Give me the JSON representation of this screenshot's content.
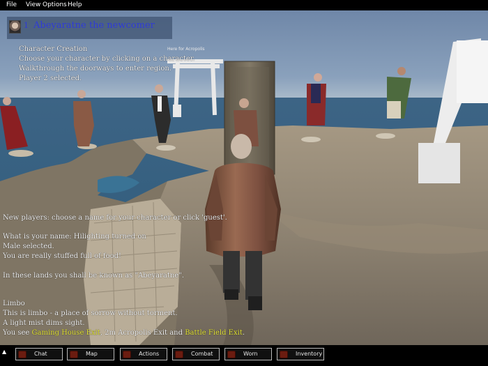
{
  "menu": [
    "File",
    "View",
    "Options",
    "Help"
  ],
  "player": {
    "number": "1",
    "name": "Abeyaratne the newcomer"
  },
  "sign_label": "Here for Acropolis",
  "intro_lines": [
    "Character Creation",
    "Choose your character by clicking on a character.",
    "Walkthrough the doorways to enter region.",
    "Player 2 selected."
  ],
  "chat_lines": [
    "New players: choose a name for your character or click 'guest'.",
    "What is your name: Hilighting turned on",
    "Male selected.",
    "You are really stuffed full of food!",
    "In these lands you shall be known as \"Abeyaratne\".",
    "Limbo",
    "This is limbo - a place of sorrow without torment.",
    "A light mist dims sight."
  ],
  "exits_line": {
    "prefix": "You see ",
    "exit1": "Gaming House Exit",
    "middle": ", 2m Acropolis Exit and ",
    "exit2": "Battle Field Exit",
    "suffix": "."
  },
  "buttons": [
    "Chat",
    "Map",
    "Actions",
    "Combat",
    "Worn",
    "Inventory"
  ],
  "colors": {
    "highlight": "#e8e83a",
    "player_name": "#2f3bd6",
    "text": "#f2f2f2"
  }
}
